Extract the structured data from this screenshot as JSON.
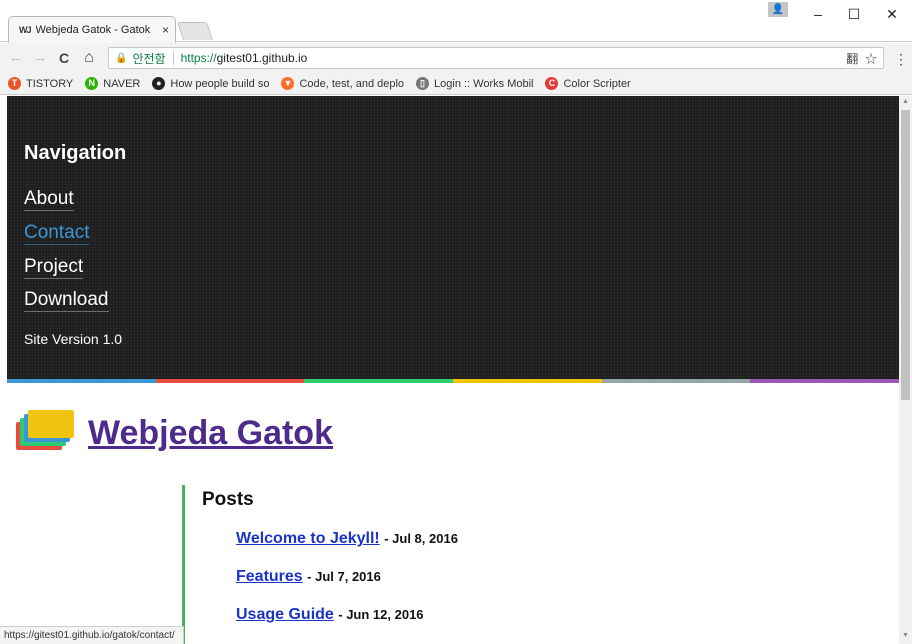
{
  "browser": {
    "tab_title": "Webjeda Gatok - Gatok",
    "tab_close": "×",
    "tab_favicon": "WJ",
    "window_controls": {
      "minimize": "–",
      "maximize": "☐",
      "close": "✕"
    },
    "nav": {
      "back": "←",
      "forward": "→",
      "reload": "C",
      "home": "⌂"
    },
    "omnibox": {
      "lock": "🔒",
      "secure_label": "안전함",
      "url_scheme": "https://",
      "url_host": "gitest01.github.io",
      "translate_icon": "翻",
      "star_icon": "☆"
    },
    "menu_icon": "⋮",
    "bookmarks": [
      {
        "label": "TISTORY",
        "icon": "tistory-icon",
        "glyph": "T",
        "color": "#e8562a"
      },
      {
        "label": "NAVER",
        "icon": "naver-icon",
        "glyph": "N",
        "color": "#2db400"
      },
      {
        "label": "How people build so",
        "icon": "github-icon",
        "glyph": "●",
        "color": "#222222"
      },
      {
        "label": "Code, test, and deplo",
        "icon": "gitlab-icon",
        "glyph": "▼",
        "color": "#fc6d26"
      },
      {
        "label": "Login :: Works Mobil",
        "icon": "page-icon",
        "glyph": "▯",
        "color": "#777777"
      },
      {
        "label": "Color Scripter",
        "icon": "colorscripter-icon",
        "glyph": "C",
        "color": "#e53935"
      }
    ],
    "status_url": "https://gitest01.github.io/gatok/contact/"
  },
  "sidebar": {
    "heading": "Navigation",
    "links": [
      {
        "label": "About",
        "active": false
      },
      {
        "label": "Contact",
        "active": true
      },
      {
        "label": "Project",
        "active": false
      },
      {
        "label": "Download",
        "active": false
      }
    ],
    "version": "Site Version 1.0"
  },
  "colors": {
    "strip": [
      "#3b97d3",
      "#e74c3c",
      "#2ecc71",
      "#f1c40f",
      "#95a5a6",
      "#9b59b6"
    ],
    "logo_layers": [
      "#e74c3c",
      "#2ecc71",
      "#3b97d3",
      "#f1c40f"
    ],
    "title": "#4d2a8c",
    "post_link": "#1a34c8",
    "accent_rule": "#43b75a"
  },
  "site": {
    "title": "Webjeda Gatok"
  },
  "posts": {
    "heading": "Posts",
    "items": [
      {
        "title": "Welcome to Jekyll!",
        "date": "- Jul 8, 2016"
      },
      {
        "title": "Features",
        "date": "- Jul 7, 2016"
      },
      {
        "title": "Usage Guide",
        "date": "- Jun 12, 2016"
      }
    ]
  }
}
